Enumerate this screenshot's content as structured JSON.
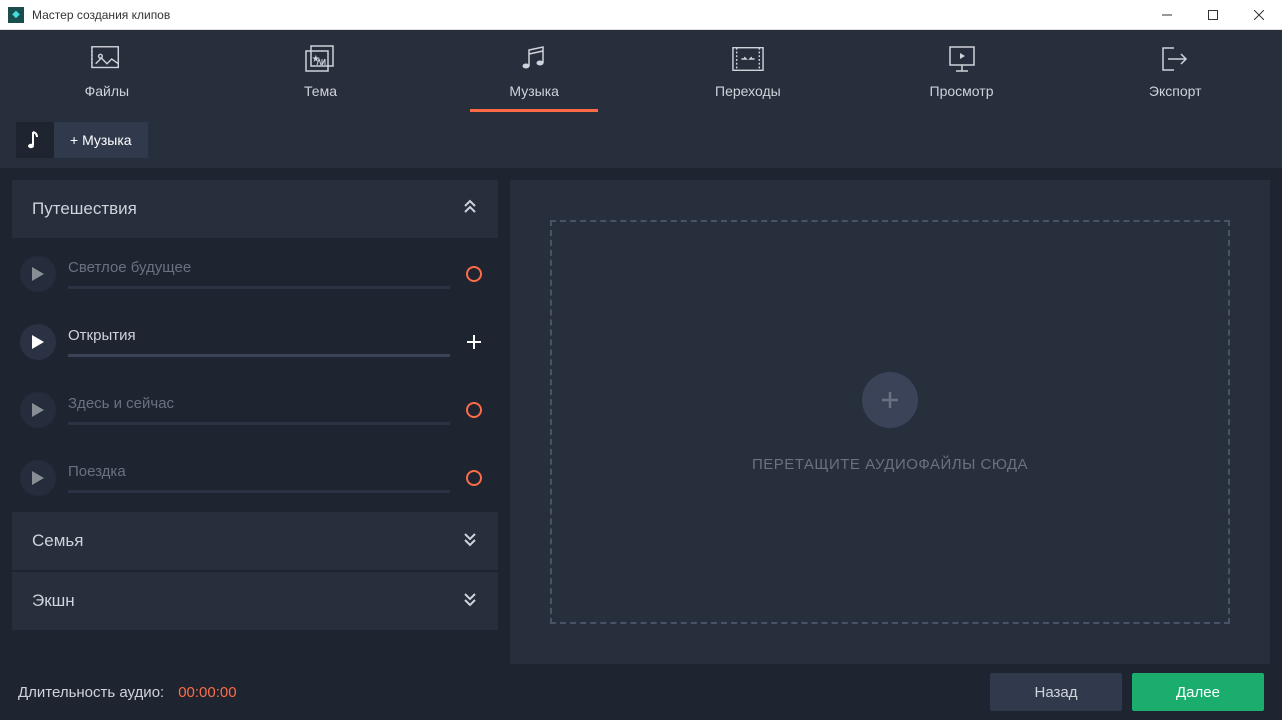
{
  "window": {
    "title": "Мастер создания клипов"
  },
  "nav": {
    "files": "Файлы",
    "theme": "Тема",
    "music": "Музыка",
    "transitions": "Переходы",
    "preview": "Просмотр",
    "export": "Экспорт"
  },
  "toolbar": {
    "add_music": "+ Музыка"
  },
  "categories": {
    "travel": {
      "title": "Путешествия",
      "tracks": [
        {
          "name": "Светлое будущее",
          "active": false,
          "action": "loading"
        },
        {
          "name": "Открытия",
          "active": true,
          "action": "add"
        },
        {
          "name": "Здесь и сейчас",
          "active": false,
          "action": "loading"
        },
        {
          "name": "Поездка",
          "active": false,
          "action": "loading"
        }
      ]
    },
    "family": {
      "title": "Семья"
    },
    "action": {
      "title": "Экшн"
    }
  },
  "dropzone": {
    "text": "ПЕРЕТАЩИТЕ АУДИОФАЙЛЫ СЮДА"
  },
  "footer": {
    "duration_label": "Длительность аудио:",
    "duration_value": "00:00:00",
    "back": "Назад",
    "next": "Далее"
  }
}
